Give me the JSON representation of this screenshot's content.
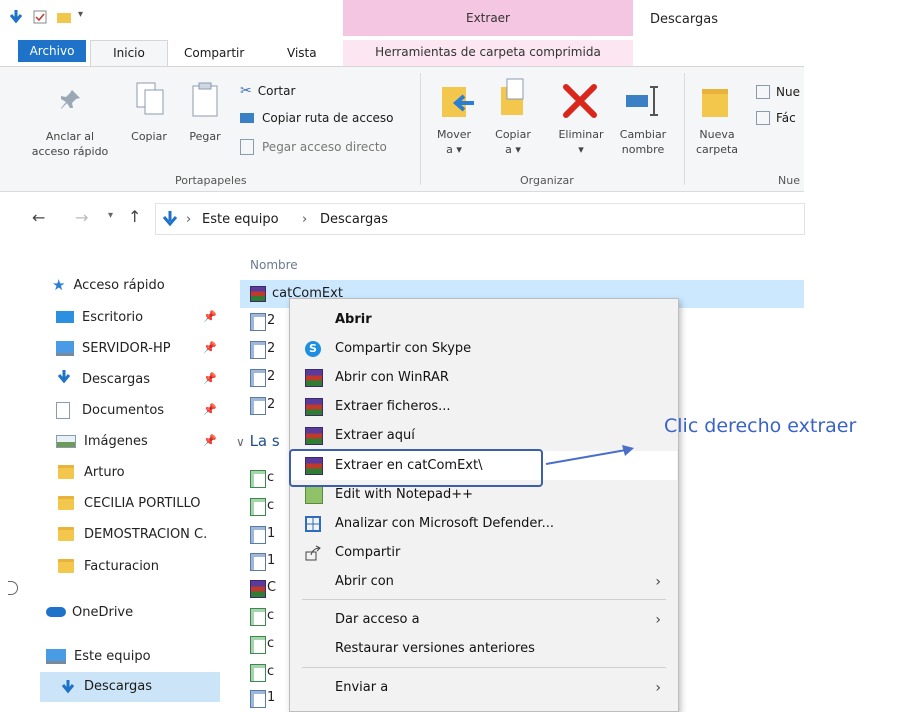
{
  "titlebar": {
    "context_tab": "Extraer",
    "window_title": "Descargas"
  },
  "tabs": {
    "archivo": "Archivo",
    "inicio": "Inicio",
    "compartir": "Compartir",
    "vista": "Vista",
    "herramientas": "Herramientas de carpeta comprimida"
  },
  "ribbon": {
    "anclar": [
      "Anclar al",
      "acceso rápido"
    ],
    "copiar": "Copiar",
    "pegar": "Pegar",
    "cortar": "Cortar",
    "copiar_ruta": "Copiar ruta de acceso",
    "pegar_acceso": "Pegar acceso directo",
    "portapapeles": "Portapapeles",
    "mover": [
      "Mover",
      "a ▾"
    ],
    "copiar_a": [
      "Copiar",
      "a ▾"
    ],
    "eliminar": [
      "Eliminar",
      "▾"
    ],
    "cambiar": [
      "Cambiar",
      "nombre"
    ],
    "organizar": "Organizar",
    "nueva_carpeta": [
      "Nueva",
      "carpeta"
    ],
    "nuevo_partial": "Nue",
    "facil_partial": "Fác",
    "nuevo_group_partial": "Nue"
  },
  "address": {
    "segments": [
      "Este equipo",
      "Descargas"
    ],
    "separator": "›"
  },
  "sidebar": {
    "acceso_rapido": "Acceso rápido",
    "items": [
      {
        "label": "Escritorio",
        "pinned": true
      },
      {
        "label": "SERVIDOR-HP",
        "pinned": true
      },
      {
        "label": "Descargas",
        "pinned": true
      },
      {
        "label": "Documentos",
        "pinned": true
      },
      {
        "label": "Imágenes",
        "pinned": true
      },
      {
        "label": "Arturo",
        "pinned": false
      },
      {
        "label": "CECILIA PORTILLO",
        "pinned": false
      },
      {
        "label": "DEMOSTRACION C.",
        "pinned": false
      },
      {
        "label": "Facturacion",
        "pinned": false
      }
    ],
    "onedrive": "OneDrive",
    "este_equipo": "Este equipo",
    "descargas": "Descargas"
  },
  "filelist": {
    "column_nombre": "Nombre",
    "selected_file": "catComExt",
    "group_partial": "La s",
    "rows_partial": [
      "2",
      "2",
      "2",
      "2",
      "c",
      "c",
      "1",
      "1",
      "C",
      "c",
      "c",
      "c",
      "1"
    ]
  },
  "context_menu": {
    "items": [
      {
        "label": "Abrir",
        "bold": true,
        "icon": ""
      },
      {
        "label": "Compartir con Skype",
        "icon": "skype-icon"
      },
      {
        "label": "Abrir con WinRAR",
        "icon": "winrar-icon"
      },
      {
        "label": "Extraer ficheros...",
        "icon": "winrar-icon"
      },
      {
        "label": "Extraer aquí",
        "icon": "winrar-icon"
      },
      {
        "label": "Extraer en catComExt\\",
        "icon": "winrar-icon"
      },
      {
        "label": "Edit with Notepad++",
        "icon": "notepad-icon"
      },
      {
        "label": "Analizar con Microsoft Defender...",
        "icon": "defender-icon"
      },
      {
        "label": "Compartir",
        "icon": "share-icon"
      },
      {
        "label": "Abrir con",
        "icon": "",
        "submenu": true
      },
      {
        "label": "Dar acceso a",
        "icon": "",
        "submenu": true
      },
      {
        "label": "Restaurar versiones anteriores",
        "icon": ""
      },
      {
        "label": "Enviar a",
        "icon": "",
        "submenu": true
      }
    ],
    "submenu_arrow": "›"
  },
  "annotation": {
    "text": "Clic derecho extraer"
  },
  "colors": {
    "accent": "#1e72c8",
    "context_tab": "#f4c6e1",
    "annotation": "#3a63c9",
    "highlight_box": "#3d5ea8",
    "delete_red": "#d9271c"
  }
}
